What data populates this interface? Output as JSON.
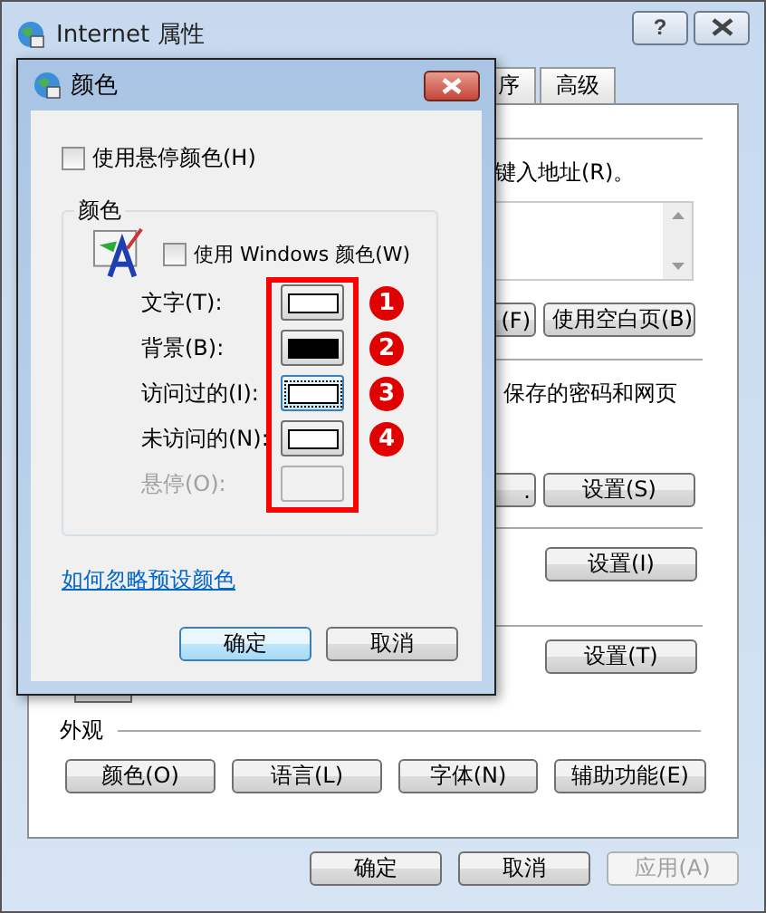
{
  "window": {
    "title": "Internet 属性",
    "help_button": "?"
  },
  "tabs": [
    {
      "label": "序",
      "selected": false
    },
    {
      "label": "高级",
      "selected": false
    }
  ],
  "general_panel": {
    "address_hint": "键入地址(R)。",
    "home_buttons": [
      "(F)",
      "使用空白页(B)"
    ],
    "history_text": "保存的密码和网页",
    "history_buttons": [
      ".",
      "设置(S)"
    ],
    "settings_buttons": [
      "设置(I)",
      "设置(T)"
    ],
    "appearance": {
      "title": "外观",
      "buttons": [
        "颜色(O)",
        "语言(L)",
        "字体(N)",
        "辅助功能(E)"
      ]
    }
  },
  "footer_buttons": [
    {
      "label": "确定",
      "disabled": false
    },
    {
      "label": "取消",
      "disabled": false
    },
    {
      "label": "应用(A)",
      "disabled": true
    }
  ],
  "colors_dialog": {
    "title": "颜色",
    "hover_checkbox": {
      "label": "使用悬停颜色(H)",
      "checked": false
    },
    "group_title": "颜色",
    "windows_checkbox": {
      "label": "使用 Windows 颜色(W)",
      "checked": false
    },
    "rows": [
      {
        "label": "文字(T):",
        "color": "#ffffff",
        "disabled": false,
        "focused": false,
        "badge": "1"
      },
      {
        "label": "背景(B):",
        "color": "#000000",
        "disabled": false,
        "focused": false,
        "badge": "2"
      },
      {
        "label": "访问过的(I):",
        "color": "#ffffff",
        "disabled": false,
        "focused": true,
        "badge": "3"
      },
      {
        "label": "未访问的(N):",
        "color": "#ffffff",
        "disabled": false,
        "focused": false,
        "badge": "4"
      },
      {
        "label": "悬停(O):",
        "disabled": true,
        "focused": false
      }
    ],
    "link": "如何忽略预设颜色",
    "buttons": [
      {
        "label": "确定",
        "default": true
      },
      {
        "label": "取消",
        "default": false
      }
    ]
  }
}
